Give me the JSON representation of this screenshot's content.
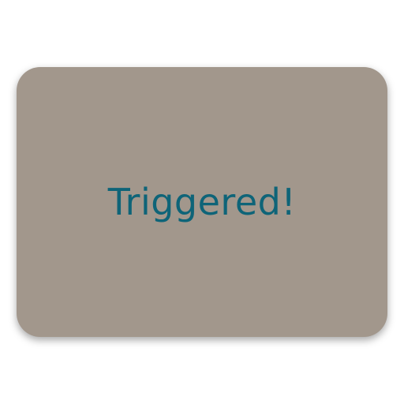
{
  "card": {
    "message": "Triggered!",
    "background_color": "#a2978c",
    "text_color": "#0e6478"
  }
}
